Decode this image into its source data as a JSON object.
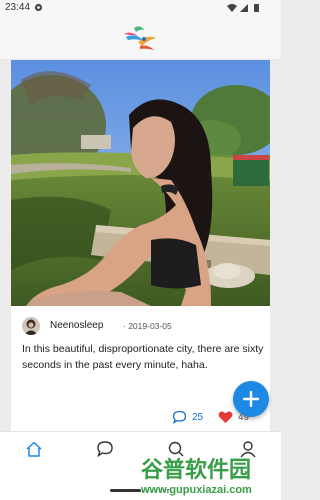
{
  "status_bar": {
    "time": "23:44"
  },
  "post": {
    "author": "Neenosleep",
    "date": "2019-03-05",
    "text": "In this beautiful, disproportionate city, there are sixty seconds in the past every minute, haha.",
    "comment_count": "25",
    "like_count": "49"
  },
  "colors": {
    "accent": "#1e88e5",
    "like": "#e53935"
  },
  "icons": {
    "fab": "plus-icon",
    "nav": [
      "home-icon",
      "chat-bubble-icon",
      "search-icon",
      "profile-icon"
    ]
  },
  "watermark": {
    "title": "谷普软件园",
    "url": "www.gupuxiazai.com"
  }
}
